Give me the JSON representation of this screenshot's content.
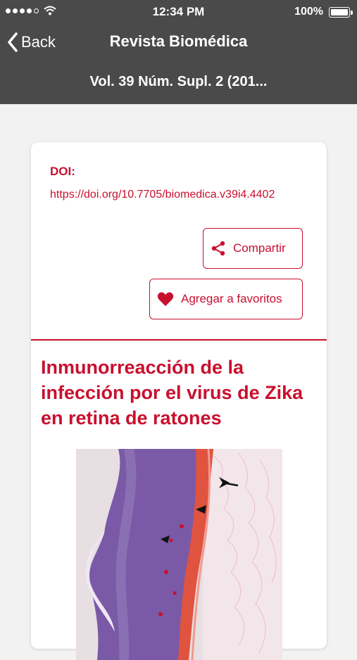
{
  "status_bar": {
    "time": "12:34 PM",
    "battery": "100%"
  },
  "nav": {
    "back_label": "Back",
    "title": "Revista Biomédica",
    "subtitle": "Vol. 39 Núm. Supl. 2 (201..."
  },
  "article": {
    "doi_label": "DOI:",
    "doi_url": "https://doi.org/10.7705/biomedica.v39i4.4402",
    "share_label": "Compartir",
    "favorite_label": "Agregar a favoritos",
    "title": "Inmunorreacción de la infección por el virus de Zika en retina de ratones"
  },
  "colors": {
    "accent": "#c8102e",
    "header_bg": "#4a4a4a",
    "page_bg": "#f2f2f2"
  }
}
